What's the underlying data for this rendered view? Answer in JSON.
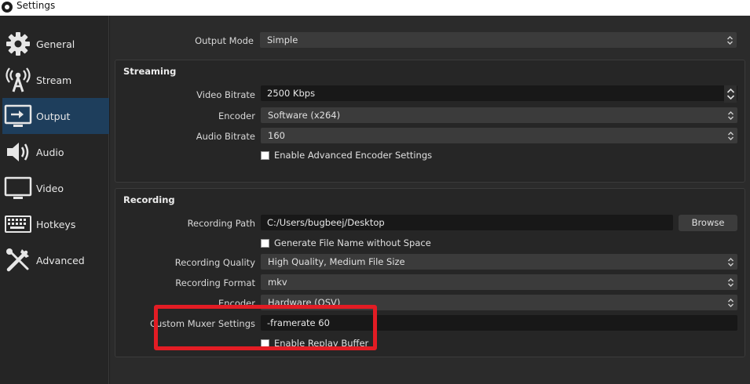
{
  "window": {
    "title": "Settings"
  },
  "sidebar": {
    "items": [
      {
        "label": "General",
        "icon": "gear-icon"
      },
      {
        "label": "Stream",
        "icon": "broadcast-icon"
      },
      {
        "label": "Output",
        "icon": "monitor-output-icon",
        "active": true
      },
      {
        "label": "Audio",
        "icon": "speaker-icon"
      },
      {
        "label": "Video",
        "icon": "monitor-icon"
      },
      {
        "label": "Hotkeys",
        "icon": "keyboard-icon"
      },
      {
        "label": "Advanced",
        "icon": "tools-icon"
      }
    ]
  },
  "output_mode": {
    "label": "Output Mode",
    "value": "Simple"
  },
  "streaming": {
    "title": "Streaming",
    "video_bitrate": {
      "label": "Video Bitrate",
      "value": "2500 Kbps"
    },
    "encoder": {
      "label": "Encoder",
      "value": "Software (x264)"
    },
    "audio_bitrate": {
      "label": "Audio Bitrate",
      "value": "160"
    },
    "advanced_encoder": {
      "label": "Enable Advanced Encoder Settings",
      "checked": false
    }
  },
  "recording": {
    "title": "Recording",
    "path": {
      "label": "Recording Path",
      "value": "C:/Users/bugbeej/Desktop"
    },
    "browse_label": "Browse",
    "filename_nospace": {
      "label": "Generate File Name without Space",
      "checked": false
    },
    "quality": {
      "label": "Recording Quality",
      "value": "High Quality, Medium File Size"
    },
    "format": {
      "label": "Recording Format",
      "value": "mkv"
    },
    "encoder": {
      "label": "Encoder",
      "value": "Hardware (QSV)"
    },
    "muxer": {
      "label": "Custom Muxer Settings",
      "value": "-framerate 60"
    },
    "replay_buffer": {
      "label": "Enable Replay Buffer",
      "checked": false
    }
  },
  "colors": {
    "highlight": "#e31c24",
    "active_nav": "#1e3e5c",
    "background": "#2b2b2b"
  }
}
